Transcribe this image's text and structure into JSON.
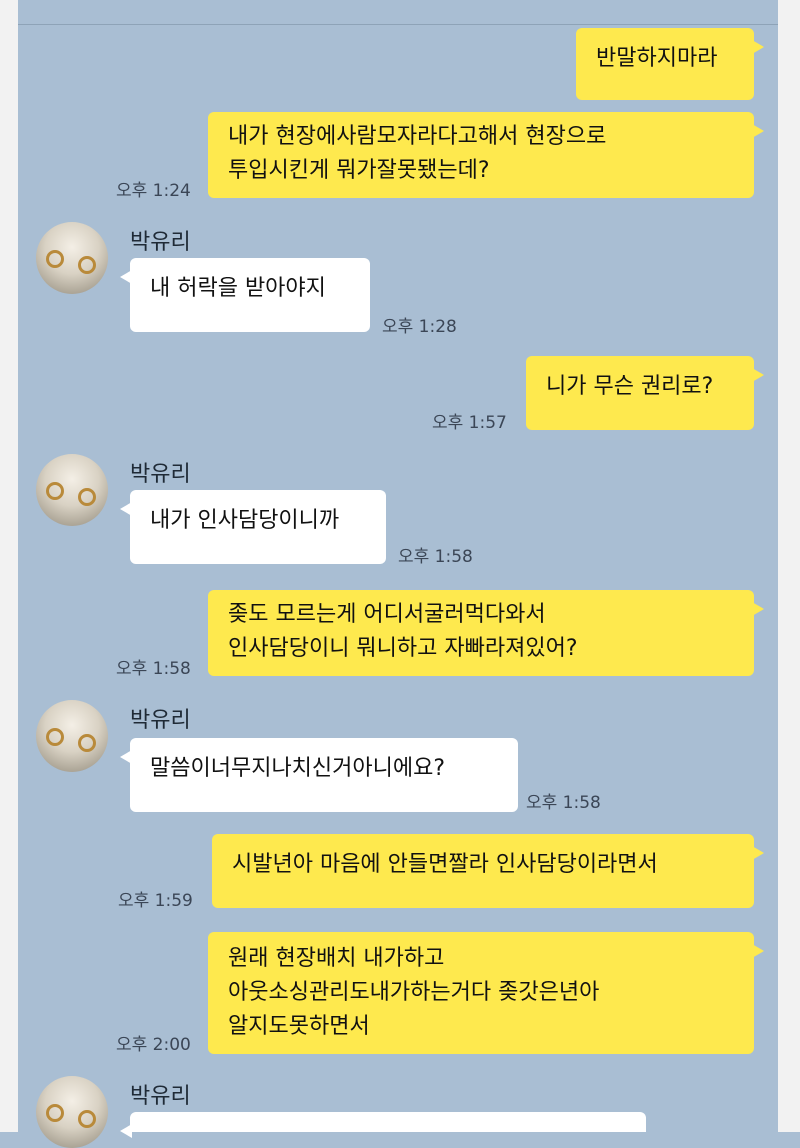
{
  "contact_name": "박유리",
  "messages": [
    {
      "side": "mine",
      "lines": [
        "반말하지마라"
      ],
      "time": ""
    },
    {
      "side": "mine",
      "lines": [
        "내가 현장에사람모자라다고해서 현장으로",
        "투입시킨게 뭐가잘못됐는데?"
      ],
      "time": "오후 1:24"
    },
    {
      "side": "theirs",
      "lines": [
        "내 허락을 받아야지"
      ],
      "time": "오후 1:28"
    },
    {
      "side": "mine",
      "lines": [
        "니가 무슨 권리로?"
      ],
      "time": "오후 1:57"
    },
    {
      "side": "theirs",
      "lines": [
        "내가 인사담당이니까"
      ],
      "time": "오후 1:58"
    },
    {
      "side": "mine",
      "lines": [
        "좆도 모르는게 어디서굴러먹다와서",
        "인사담당이니 뭐니하고 자빠라져있어?"
      ],
      "time": "오후 1:58"
    },
    {
      "side": "theirs",
      "lines": [
        "말씀이너무지나치신거아니에요?"
      ],
      "time": "오후 1:58"
    },
    {
      "side": "mine",
      "lines": [
        "시발년아 마음에 안들면짤라 인사담당이라면서"
      ],
      "time": "오후 1:59"
    },
    {
      "side": "mine",
      "lines": [
        "원래 현장배치 내가하고",
        "아웃소싱관리도내가하는거다 좆갓은년아",
        "알지도못하면서"
      ],
      "time": "오후 2:00"
    },
    {
      "side": "theirs",
      "lines": [
        ""
      ],
      "time": ""
    }
  ],
  "colors": {
    "background": "#a9bed3",
    "my_bubble": "#fee94e",
    "their_bubble": "#ffffff"
  }
}
